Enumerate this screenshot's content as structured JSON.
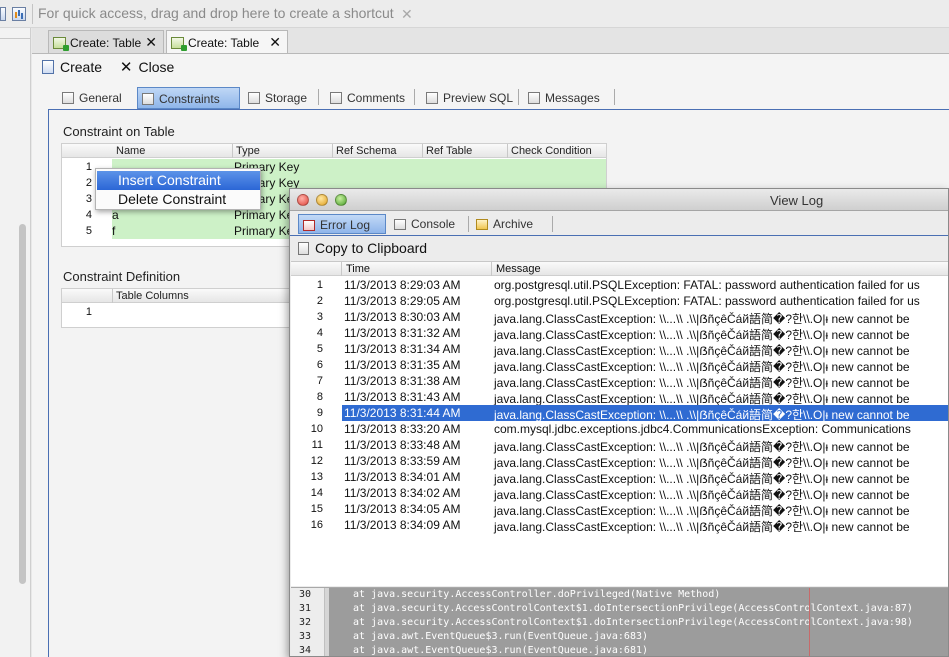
{
  "toolbar": {
    "shortcut_hint": "For quick access, drag and drop here to create a shortcut",
    "shortcut_close": "✕"
  },
  "editor_tabs": [
    {
      "label": "Create: Table",
      "active": false
    },
    {
      "label": "Create: Table",
      "active": true
    }
  ],
  "actions": {
    "create": "Create",
    "close": "Close"
  },
  "sub_tabs": [
    "General",
    "Constraints",
    "Storage",
    "Comments",
    "Preview SQL",
    "Messages"
  ],
  "active_sub_tab": "Constraints",
  "constraint_table": {
    "title": "Constraint on Table",
    "columns": [
      "Name",
      "Type",
      "Ref Schema",
      "Ref Table",
      "Check Condition"
    ],
    "rows": [
      {
        "num": "1",
        "name": "",
        "type": "Primary Key"
      },
      {
        "num": "2",
        "name": "",
        "type": "Primary Key"
      },
      {
        "num": "3",
        "name": "",
        "type": "Primary Key"
      },
      {
        "num": "4",
        "name": "a",
        "type": "Primary Key"
      },
      {
        "num": "5",
        "name": "f",
        "type": "Primary Key"
      }
    ]
  },
  "constraint_definition": {
    "title": "Constraint Definition",
    "columns": [
      "Table Columns"
    ],
    "rows": [
      {
        "num": "1"
      }
    ]
  },
  "context_menu": {
    "items": [
      "Insert Constraint",
      "Delete Constraint"
    ],
    "highlighted": "Insert Constraint"
  },
  "view_log": {
    "title": "View Log",
    "tabs": [
      "Error Log",
      "Console",
      "Archive"
    ],
    "active_tab": "Error Log",
    "copy_label": "Copy to Clipboard",
    "columns": [
      "Time",
      "Message"
    ],
    "rows": [
      {
        "num": "1",
        "time": "11/3/2013 8:29:03 AM",
        "message": "org.postgresql.util.PSQLException: FATAL: password authentication failed for us"
      },
      {
        "num": "2",
        "time": "11/3/2013 8:29:05 AM",
        "message": "org.postgresql.util.PSQLException: FATAL: password authentication failed for us"
      },
      {
        "num": "3",
        "time": "11/3/2013 8:30:03 AM",
        "message": "java.lang.ClassCastException: \\\\...\\\\ .\\\\|ẞñçêČáй語简�?한\\\\.O|ᵻ new cannot be"
      },
      {
        "num": "4",
        "time": "11/3/2013 8:31:32 AM",
        "message": "java.lang.ClassCastException: \\\\...\\\\ .\\\\|ẞñçêČáй語简�?한\\\\.O|ᵻ new cannot be"
      },
      {
        "num": "5",
        "time": "11/3/2013 8:31:34 AM",
        "message": "java.lang.ClassCastException: \\\\...\\\\ .\\\\|ẞñçêČáй語简�?한\\\\.O|ᵻ new cannot be"
      },
      {
        "num": "6",
        "time": "11/3/2013 8:31:35 AM",
        "message": "java.lang.ClassCastException: \\\\...\\\\ .\\\\|ẞñçêČáй語简�?한\\\\.O|ᵻ new cannot be"
      },
      {
        "num": "7",
        "time": "11/3/2013 8:31:38 AM",
        "message": "java.lang.ClassCastException: \\\\...\\\\ .\\\\|ẞñçêČáй語简�?한\\\\.O|ᵻ new cannot be"
      },
      {
        "num": "8",
        "time": "11/3/2013 8:31:43 AM",
        "message": "java.lang.ClassCastException: \\\\...\\\\ .\\\\|ẞñçêČáй語简�?한\\\\.O|ᵻ new cannot be"
      },
      {
        "num": "9",
        "time": "11/3/2013 8:31:44 AM",
        "message": "java.lang.ClassCastException: \\\\...\\\\ .\\\\|ẞñçêČáй語简�?한\\\\.O|ᵻ new cannot be",
        "selected": true
      },
      {
        "num": "10",
        "time": "11/3/2013 8:33:20 AM",
        "message": "com.mysql.jdbc.exceptions.jdbc4.CommunicationsException: Communications"
      },
      {
        "num": "11",
        "time": "11/3/2013 8:33:48 AM",
        "message": "java.lang.ClassCastException: \\\\...\\\\ .\\\\|ẞñçêČáй語简�?한\\\\.O|ᵻ new cannot be"
      },
      {
        "num": "12",
        "time": "11/3/2013 8:33:59 AM",
        "message": "java.lang.ClassCastException: \\\\...\\\\ .\\\\|ẞñçêČáй語简�?한\\\\.O|ᵻ new cannot be"
      },
      {
        "num": "13",
        "time": "11/3/2013 8:34:01 AM",
        "message": "java.lang.ClassCastException: \\\\...\\\\ .\\\\|ẞñçêČáй語简�?한\\\\.O|ᵻ new cannot be"
      },
      {
        "num": "14",
        "time": "11/3/2013 8:34:02 AM",
        "message": "java.lang.ClassCastException: \\\\...\\\\ .\\\\|ẞñçêČáй語简�?한\\\\.O|ᵻ new cannot be"
      },
      {
        "num": "15",
        "time": "11/3/2013 8:34:05 AM",
        "message": "java.lang.ClassCastException: \\\\...\\\\ .\\\\|ẞñçêČáй語简�?한\\\\.O|ᵻ new cannot be"
      },
      {
        "num": "16",
        "time": "11/3/2013 8:34:09 AM",
        "message": "java.lang.ClassCastException: \\\\...\\\\ .\\\\|ẞñçêČáй語简�?한\\\\.O|ᵻ new cannot be"
      }
    ],
    "trace": [
      {
        "num": "30",
        "text": "at java.security.AccessController.doPrivileged(Native Method)"
      },
      {
        "num": "31",
        "text": "at java.security.AccessControlContext$1.doIntersectionPrivilege(AccessControlContext.java:87)"
      },
      {
        "num": "32",
        "text": "at java.security.AccessControlContext$1.doIntersectionPrivilege(AccessControlContext.java:98)"
      },
      {
        "num": "33",
        "text": "at java.awt.EventQueue$3.run(EventQueue.java:683)"
      },
      {
        "num": "34",
        "text": "at java.awt.EventQueue$3.run(EventQueue.java:681)"
      }
    ]
  },
  "colors": {
    "selection": "#2f6bd2",
    "constraint_green": "#cdf1c7",
    "menu_highlight": "#2b66d6"
  }
}
